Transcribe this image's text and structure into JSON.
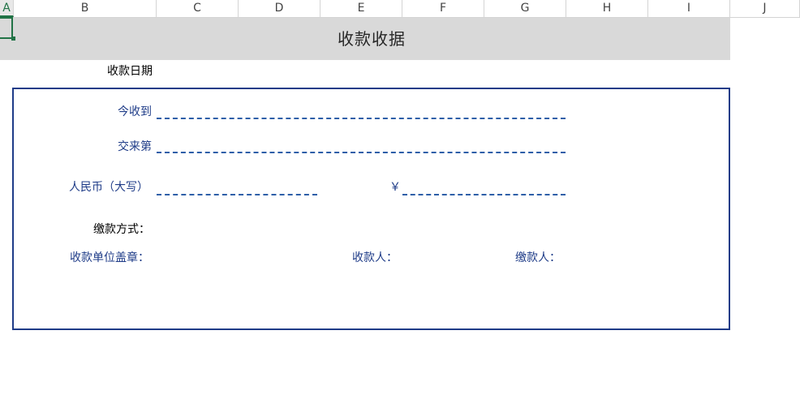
{
  "columns": [
    "A",
    "B",
    "C",
    "D",
    "E",
    "F",
    "G",
    "H",
    "I",
    "J"
  ],
  "sheet": {
    "title": "收款收据",
    "date_label": "收款日期"
  },
  "receipt": {
    "received_from_label": "今收到",
    "paid_for_label": "交来第",
    "rmb_uppercase_label": "人民币（大写）",
    "yuan_symbol": "￥",
    "payment_method_label": "缴款方式：",
    "payee_unit_seal_label": "收款单位盖章：",
    "payee_label": "收款人：",
    "payer_label": "缴款人："
  },
  "colors": {
    "accent_green": "#217346",
    "border_blue": "#1f3c88",
    "dash_blue": "#2e5fa8",
    "title_band": "#d9d9d9"
  }
}
